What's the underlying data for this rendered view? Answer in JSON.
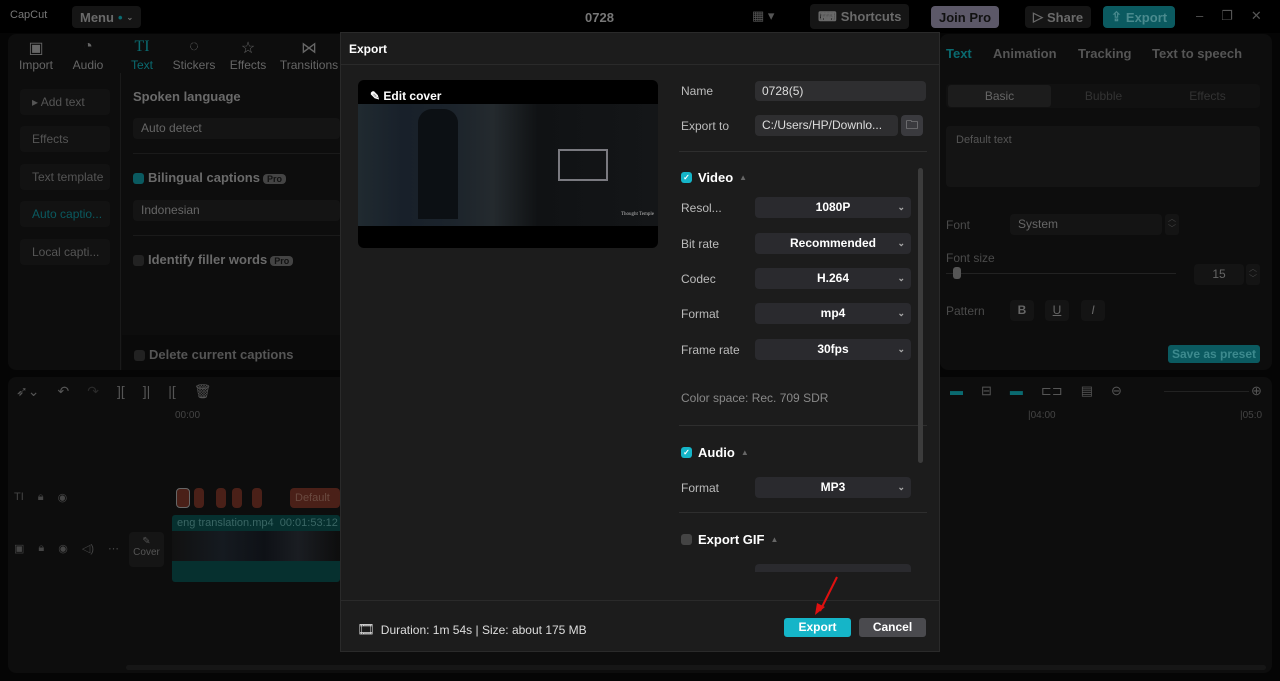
{
  "app": {
    "logo": "CapCut",
    "menu": "Menu",
    "project_title": "0728",
    "shortcuts": "Shortcuts",
    "join_pro": "Join Pro",
    "share": "Share",
    "export": "Export"
  },
  "left_tabs": [
    {
      "label": "Import",
      "icon": "import-icon"
    },
    {
      "label": "Audio",
      "icon": "audio-icon"
    },
    {
      "label": "Text",
      "icon": "text-icon"
    },
    {
      "label": "Stickers",
      "icon": "stickers-icon"
    },
    {
      "label": "Effects",
      "icon": "effects-icon"
    },
    {
      "label": "Transitions",
      "icon": "transitions-icon"
    }
  ],
  "side_items": [
    "Add text",
    "Effects",
    "Text template",
    "Auto captio...",
    "Local capti..."
  ],
  "captions": {
    "spoken_language_label": "Spoken language",
    "spoken_language": "Auto detect",
    "bilingual": "Bilingual captions",
    "pro": "Pro",
    "bilingual_language": "Indonesian",
    "filler": "Identify filler words",
    "delete": "Delete current captions"
  },
  "right": {
    "tabs": [
      "Text",
      "Animation",
      "Tracking",
      "Text to speech"
    ],
    "subtabs": [
      "Basic",
      "Bubble",
      "Effects"
    ],
    "default_text": "Default text",
    "font_label": "Font",
    "font": "System",
    "font_size_label": "Font size",
    "font_size": "15",
    "pattern_label": "Pattern",
    "bold": "B",
    "underline": "U",
    "italic": "I",
    "save_preset": "Save as preset"
  },
  "timeline": {
    "t0": "00:00",
    "t4": "|04:00",
    "t5": "|05:0",
    "caption_default": "Default",
    "clip_name": "eng translation.mp4",
    "clip_duration": "00:01:53:12",
    "cover": "Cover"
  },
  "dialog": {
    "title": "Export",
    "edit_cover": "Edit cover",
    "watermark": "Thought Temple",
    "name_label": "Name",
    "name": "0728(5)",
    "export_to_label": "Export to",
    "export_to": "C:/Users/HP/Downlo...",
    "video": {
      "label": "Video",
      "checked": true,
      "resolution_label": "Resol...",
      "resolution": "1080P",
      "bitrate_label": "Bit rate",
      "bitrate": "Recommended",
      "codec_label": "Codec",
      "codec": "H.264",
      "format_label": "Format",
      "format": "mp4",
      "framerate_label": "Frame rate",
      "framerate": "30fps",
      "color_space": "Color space: Rec. 709 SDR"
    },
    "audio": {
      "label": "Audio",
      "checked": true,
      "format_label": "Format",
      "format": "MP3"
    },
    "gif": {
      "label": "Export GIF",
      "checked": false
    },
    "duration": "Duration: 1m 54s | Size: about 175 MB",
    "export": "Export",
    "cancel": "Cancel"
  },
  "colors": {
    "accent": "#15b5c8",
    "dialog_bg": "#1c1c1c"
  }
}
